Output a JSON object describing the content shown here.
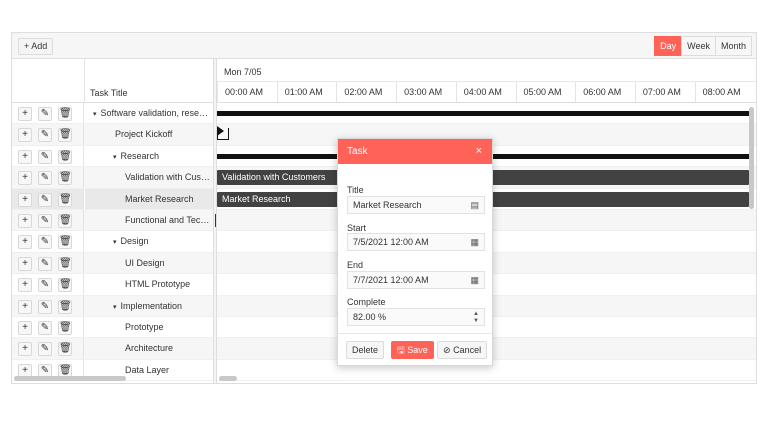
{
  "toolbar": {
    "add_label": "+ Add",
    "views": [
      "Day",
      "Week",
      "Month"
    ],
    "active_view": "Day"
  },
  "grid": {
    "title_header": "Task Title"
  },
  "timeline": {
    "date_label": "Mon 7/05",
    "hours": [
      "00:00 AM",
      "01:00 AM",
      "02:00 AM",
      "03:00 AM",
      "04:00 AM",
      "05:00 AM",
      "06:00 AM",
      "07:00 AM",
      "08:00 AM"
    ]
  },
  "tasks": [
    {
      "title": "Software validation, resea…",
      "level": 0,
      "expander": "▾"
    },
    {
      "title": "Project Kickoff",
      "level": 1,
      "expander": ""
    },
    {
      "title": "Research",
      "level": 1,
      "expander": "▾"
    },
    {
      "title": "Validation with Cus…",
      "level": 2,
      "expander": ""
    },
    {
      "title": "Market Research",
      "level": 2,
      "expander": ""
    },
    {
      "title": "Functional and Tec…",
      "level": 2,
      "expander": ""
    },
    {
      "title": "Design",
      "level": 1,
      "expander": "▾"
    },
    {
      "title": "UI Design",
      "level": 2,
      "expander": ""
    },
    {
      "title": "HTML Prototype",
      "level": 2,
      "expander": ""
    },
    {
      "title": "Implementation",
      "level": 1,
      "expander": "▾"
    },
    {
      "title": "Prototype",
      "level": 2,
      "expander": ""
    },
    {
      "title": "Architecture",
      "level": 2,
      "expander": ""
    },
    {
      "title": "Data Layer",
      "level": 2,
      "expander": ""
    }
  ],
  "bars": {
    "validation_label": "Validation with Customers",
    "market_label": "Market Research"
  },
  "dialog": {
    "title": "Task",
    "close_glyph": "×",
    "title_label": "Title",
    "title_value": "Market Research",
    "start_label": "Start",
    "start_value": "7/5/2021 12:00 AM",
    "end_label": "End",
    "end_value": "7/7/2021 12:00 AM",
    "complete_label": "Complete",
    "complete_value": "82.00 %",
    "delete_label": "Delete",
    "save_label": "Save",
    "cancel_label": "Cancel"
  },
  "colors": {
    "accent": "#ff6358",
    "task_bar": "#424242",
    "summary_bar": "#111111"
  },
  "icons": {
    "add": "plus-icon",
    "edit": "pencil-icon",
    "delete": "trash-icon",
    "calendar": "calendar-icon",
    "save": "floppy-icon",
    "cancel": "cancel-icon"
  }
}
